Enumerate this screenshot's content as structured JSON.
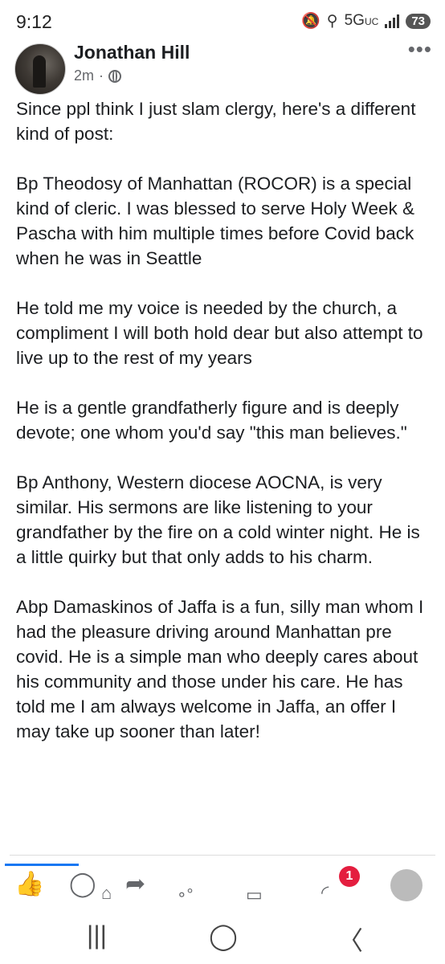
{
  "status_bar": {
    "time": "9:12",
    "network": "5G",
    "network_sub": "UC",
    "battery": "73"
  },
  "post": {
    "author": "Jonathan Hill",
    "time_ago": "2m",
    "separator": "·",
    "more_label": "•••",
    "paragraphs": [
      "Since ppl think I just slam clergy, here's a different kind of post:",
      "Bp Theodosy of Manhattan (ROCOR) is a special kind of cleric. I was blessed to serve Holy Week & Pascha with him multiple times before Covid back when he was in Seattle",
      "He told me my voice is needed by the church, a compliment I will both hold dear but also attempt to live up to the rest of my years",
      "He is a gentle grandfatherly figure and is deeply devote; one whom you'd say \"this man believes.\"",
      "Bp Anthony, Western diocese AOCNA, is very similar. His sermons are like listening to your grandfather by the fire on a cold winter night. He is a little quirky but that only adds to his charm.",
      "Abp Damaskinos of Jaffa is a fun, silly man whom I had the pleasure driving around Manhattan pre covid. He is a simple man who deeply cares about his community and those under his care. He has told me I am always welcome in Jaffa, an offer I may take up sooner than later!"
    ]
  },
  "bottom_nav": {
    "notifications_badge": "1"
  },
  "icons": {
    "like": "thumbs-up-icon",
    "comment": "comment-bubble-icon",
    "share": "share-arrow-icon"
  },
  "colors": {
    "accent": "#1877f2",
    "badge": "#e41e3f"
  }
}
